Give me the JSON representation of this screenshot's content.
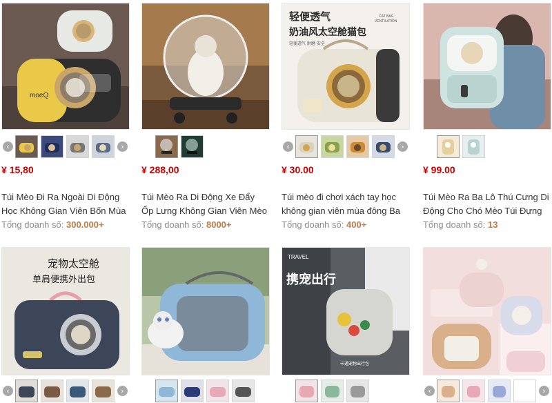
{
  "products": [
    {
      "price": "¥ 15,80",
      "title": "Túi Mèo Đi Ra Ngoài Di Động Học Không Gian Viên Bốn Mùa Ba Lô",
      "sales_label": "Tổng doanh số:",
      "sales_value": "300.000+",
      "thumb_count": 4,
      "photo_text": "moeQ"
    },
    {
      "price": "¥ 288,00",
      "title": "Túi Mèo Ra Di Động Xe Đẩy Ốp Lưng Không Gian Viên Mèo Ba Lô",
      "sales_label": "Tổng doanh số:",
      "sales_value": "8000+",
      "thumb_count": 2
    },
    {
      "price": "¥ 30.00",
      "title": "Túi mèo đi chơi xách tay học không gian viên mùa đông Ba lô",
      "sales_label": "Tổng doanh số:",
      "sales_value": "400+",
      "thumb_count": 4,
      "photo_text": "轻便透气",
      "photo_text2": "奶油风太空舱猫包",
      "photo_text3": "CAT BAG\nVENTILATION",
      "photo_text4": "CAT BAG",
      "photo_text5": "VENTILATION",
      "photo_text6": "轻便透气 耐磨 安全"
    },
    {
      "price": "¥ 99.00",
      "title": "Túi Mèo Ra Ba Lô Thú Cưng Di Động Cho Chó Mèo Túi Đựng",
      "sales_label": "Tổng doanh số:",
      "sales_value": "13",
      "thumb_count": 2
    },
    {
      "thumb_count": 4,
      "photo_text": "宠物太空舱",
      "photo_text2": "单肩便携外出包"
    },
    {
      "thumb_count": 4
    },
    {
      "thumb_count": 3,
      "photo_text": "TRAVEL",
      "photo_text2": "携宠出行",
      "photo_text3": "卡通宠物出行包"
    },
    {
      "thumb_count": 4
    }
  ],
  "icons": {
    "left": "arrow-left-icon",
    "right": "arrow-right-icon"
  },
  "colors": {
    "price": "#c40000",
    "sales_value": "#c07b45"
  }
}
